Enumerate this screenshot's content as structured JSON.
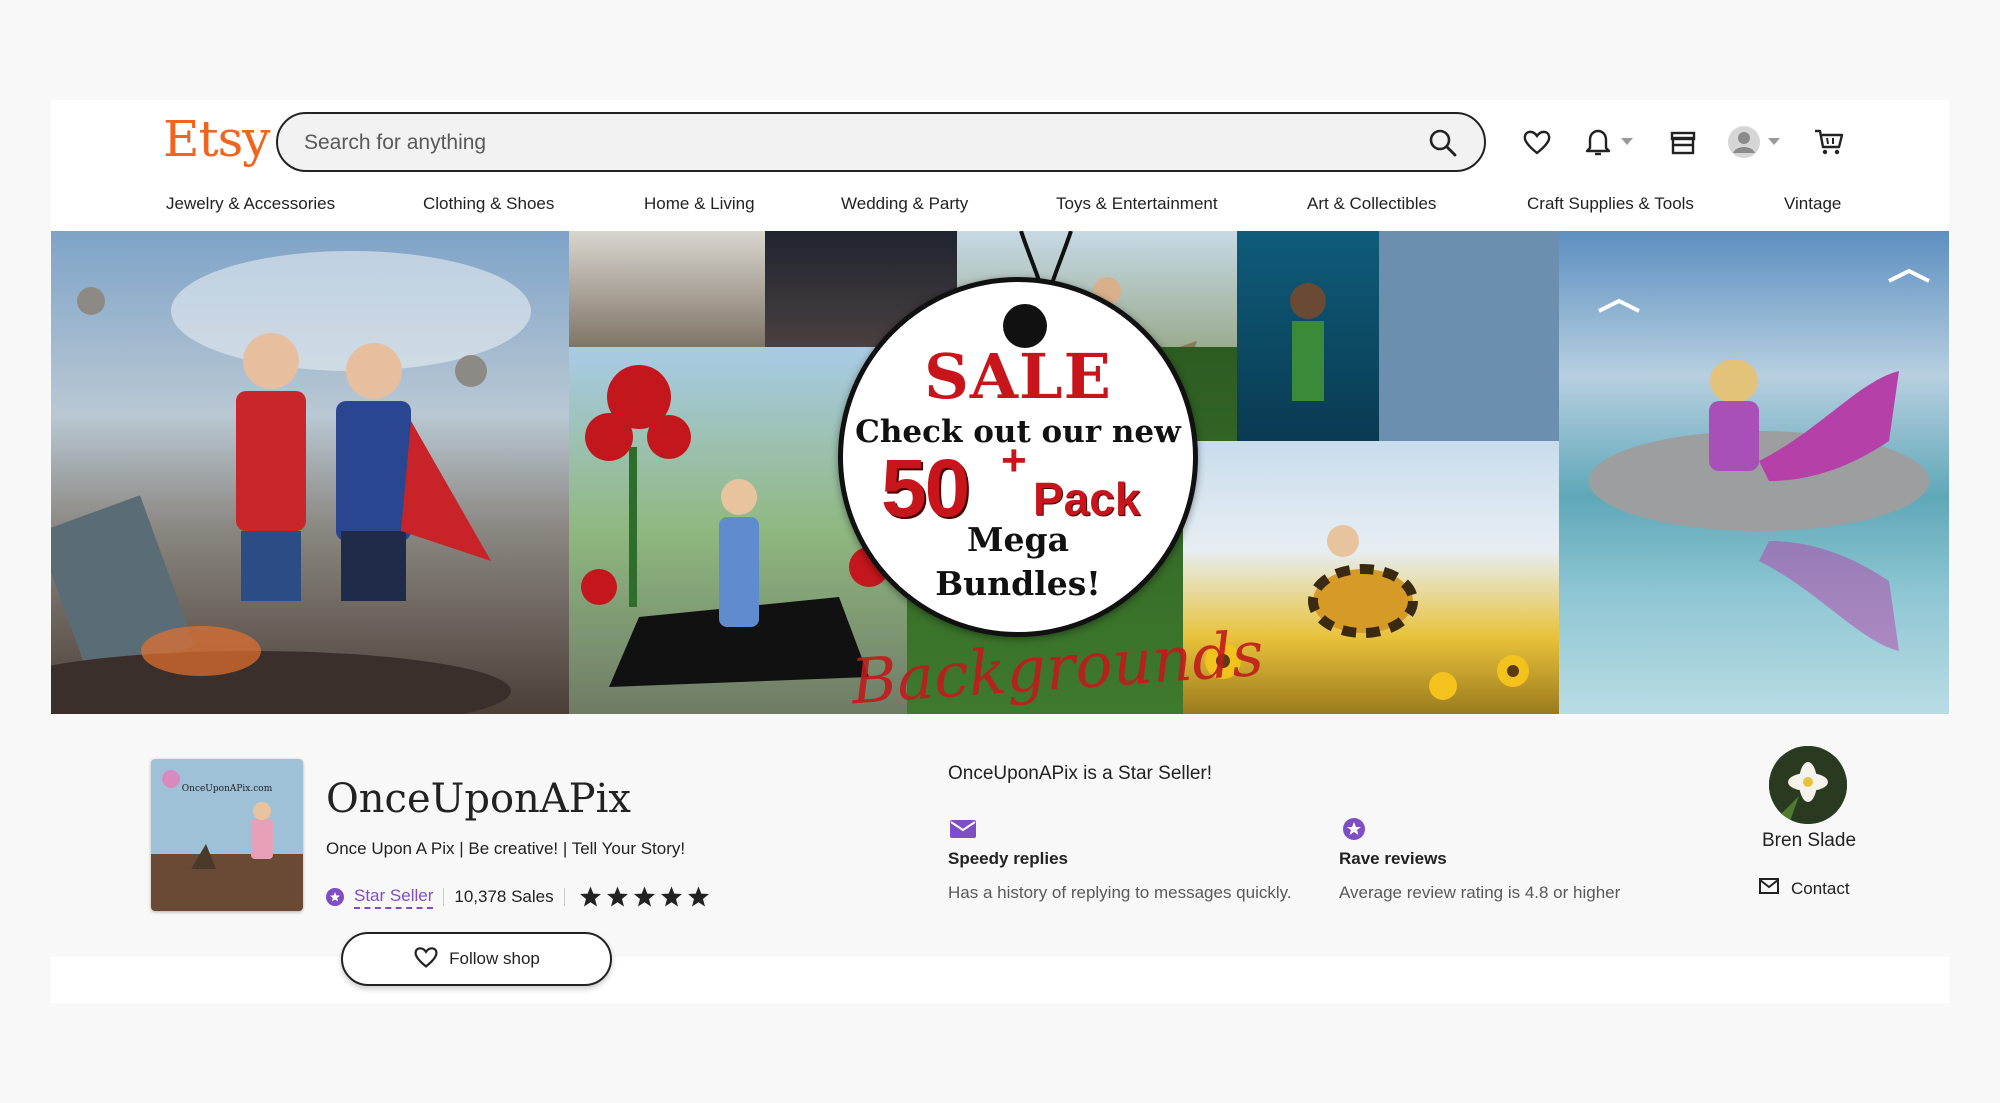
{
  "header": {
    "logo": "Etsy",
    "search_placeholder": "Search for anything"
  },
  "nav": {
    "items": [
      "Jewelry & Accessories",
      "Clothing & Shoes",
      "Home & Living",
      "Wedding & Party",
      "Toys & Entertainment",
      "Art & Collectibles",
      "Craft Supplies & Tools",
      "Vintage"
    ]
  },
  "banner": {
    "sale": "SALE",
    "line1": "Check out our new",
    "number": "50",
    "plus": "+",
    "pack": "Pack",
    "line3": "Mega",
    "line4": "Bundles!",
    "script": "Backgrounds"
  },
  "shop": {
    "name": "OnceUponAPix",
    "tagline": "Once Upon A Pix | Be creative! | Tell Your Story!",
    "star_seller_label": "Star Seller",
    "sales": "10,378 Sales",
    "rating_stars": 5,
    "follow_label": "Follow shop",
    "avatar_text": "OnceUponAPix.com"
  },
  "star_seller": {
    "title": "OnceUponAPix is a Star Seller!",
    "perks": [
      {
        "title": "Speedy replies",
        "desc": "Has a history of replying to messages quickly."
      },
      {
        "title": "Rave reviews",
        "desc": "Average review rating is 4.8 or higher"
      }
    ]
  },
  "owner": {
    "name": "Bren Slade",
    "contact_label": "Contact"
  },
  "colors": {
    "brand": "#f1641e",
    "star_seller": "#7f4dc4",
    "sale_red": "#c8151b"
  },
  "icons": [
    "search-icon",
    "heart-icon",
    "bell-icon",
    "gift-icon",
    "account-icon",
    "cart-icon",
    "mail-icon",
    "star-badge-icon"
  ]
}
